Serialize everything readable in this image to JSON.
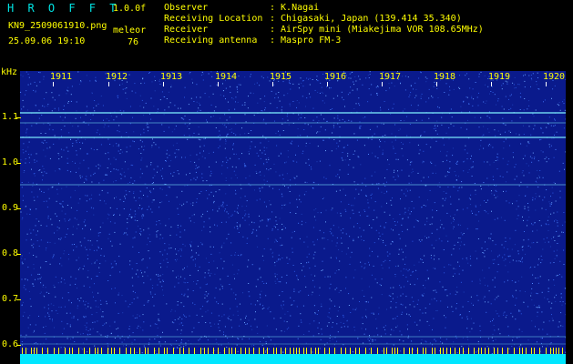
{
  "header": {
    "app_title": "H R O F F T",
    "version": "1.0.0f",
    "filename": "KN9_2509061910.png",
    "station": "meleor",
    "datetime": "25.09.06 19:10",
    "count": "76"
  },
  "metadata": [
    {
      "key": "Observer",
      "value": ": K.Nagai"
    },
    {
      "key": "Receiving Location",
      "value": ": Chigasaki, Japan (139.414 35.340)"
    },
    {
      "key": "Receiver",
      "value": ": AirSpy mini (Miakejima VOR 108.65MHz)"
    },
    {
      "key": "Receiving antenna",
      "value": ": Maspro FM-3"
    }
  ],
  "axes": {
    "y_unit": "kHz",
    "y_ticks": [
      "1.1",
      "1.0",
      "0.9",
      "0.8",
      "0.7",
      "0.6"
    ],
    "x_ticks": [
      "1911",
      "1912",
      "1913",
      "1914",
      "1915",
      "1916",
      "1917",
      "1918",
      "1919",
      "1920"
    ]
  },
  "colors": {
    "background": "#000000",
    "label": "#ffff00",
    "title": "#00e4e4",
    "plot_bg": "#0a1a8c",
    "noise": "#2f6bff",
    "line": "#7ff0ff"
  }
}
